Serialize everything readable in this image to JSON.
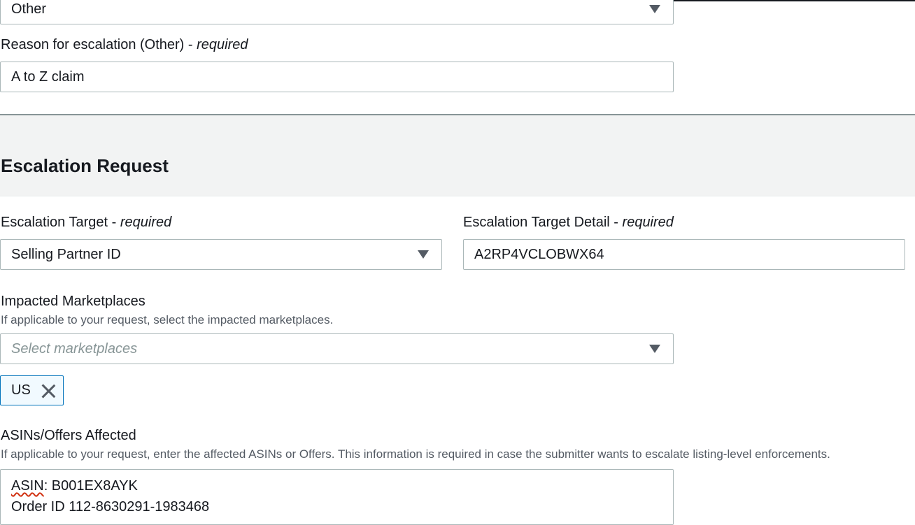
{
  "top_select": {
    "value": "Other"
  },
  "reason_field": {
    "label": "Reason for escalation (Other)",
    "required": "required",
    "value": "A to Z claim"
  },
  "section": {
    "title": "Escalation Request"
  },
  "escalation_target": {
    "label": "Escalation Target",
    "required": "required",
    "value": "Selling Partner ID"
  },
  "escalation_target_detail": {
    "label": "Escalation Target Detail",
    "required": "required",
    "value": "A2RP4VCLOBWX64"
  },
  "marketplaces": {
    "label": "Impacted Marketplaces",
    "description": "If applicable to your request, select the impacted marketplaces.",
    "placeholder": "Select marketplaces",
    "tokens": [
      "US"
    ]
  },
  "asins": {
    "label": "ASINs/Offers Affected",
    "description": "If applicable to your request, enter the affected ASINs or Offers. This information is required in case the submitter wants to escalate listing-level enforcements.",
    "line1_prefix": "ASIN",
    "line1_rest": ": B001EX8AYK",
    "line2": "Order ID 112-8630291-1983468"
  },
  "colors": {
    "border": "#aab7b8",
    "token_border": "#0073bb",
    "token_bg": "#f1faff",
    "section_bg": "#f2f3f3",
    "spellcheck": "#d13212"
  }
}
